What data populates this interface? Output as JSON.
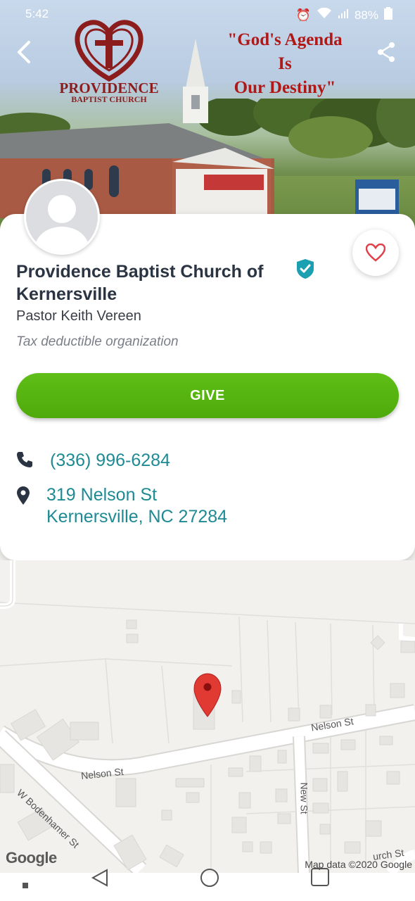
{
  "status": {
    "time": "5:42",
    "battery": "88%"
  },
  "header": {
    "logo_text": "PROVIDENCE",
    "logo_subtext": "BAPTIST CHURCH",
    "slogan_line1": "\"God's Agenda",
    "slogan_line2": "Is",
    "slogan_line3": "Our Destiny\""
  },
  "org": {
    "name": "Providence Baptist Church of Kernersville",
    "pastor": "Pastor Keith Vereen",
    "tax_note": "Tax deductible organization",
    "give_label": "GIVE",
    "phone": "(336) 996-6284",
    "address_line1": "319 Nelson St",
    "address_line2": "Kernersville, NC 27284"
  },
  "map": {
    "street_nelson_1": "Nelson St",
    "street_nelson_2": "Nelson St",
    "street_bodenhamer": "W Bodenhamer St",
    "street_new": "New St",
    "street_partial": "urch St",
    "google_label": "Google",
    "attribution": "Map data ©2020 Google"
  },
  "colors": {
    "accent": "#1f8a94",
    "give": "#56b50f",
    "verified": "#1aa0b0",
    "heart": "#e0404a",
    "pin": "#d32a2a"
  }
}
